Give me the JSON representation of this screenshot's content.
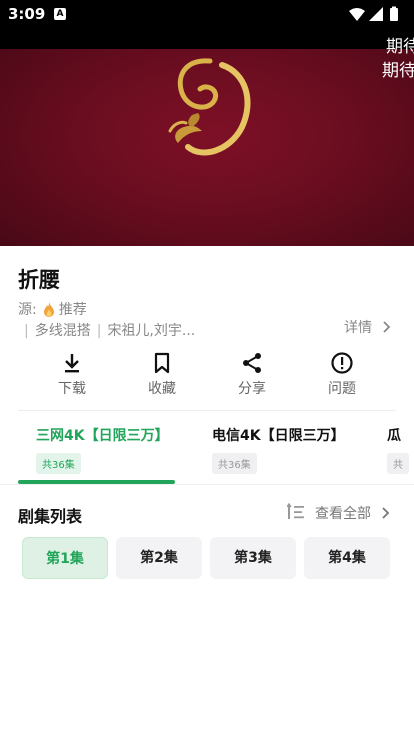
{
  "status_bar": {
    "time": "3:09",
    "notification_icon": "A",
    "icons": [
      "wifi-icon",
      "signal-icon",
      "battery-icon"
    ]
  },
  "video": {
    "danmaku": [
      "期待",
      "期待"
    ]
  },
  "show": {
    "title": "折腰",
    "source_label": "源:",
    "source_value": "推荐",
    "tags": [
      "多线混搭",
      "宋祖儿,刘宇..."
    ],
    "details_label": "详情"
  },
  "actions": [
    {
      "label": "下载",
      "icon": "download-icon"
    },
    {
      "label": "收藏",
      "icon": "bookmark-icon"
    },
    {
      "label": "分享",
      "icon": "share-icon"
    },
    {
      "label": "问题",
      "icon": "alert-icon"
    }
  ],
  "lines": [
    {
      "name": "三网4K【日限三万】",
      "count": "共36集",
      "active": true
    },
    {
      "name": "电信4K【日限三万】",
      "count": "共36集",
      "active": false
    },
    {
      "name": "瓜",
      "count": "共",
      "active": false
    }
  ],
  "episodes": {
    "heading": "剧集列表",
    "view_all": "查看全部",
    "items": [
      "第1集",
      "第2集",
      "第3集",
      "第4集"
    ]
  },
  "colors": {
    "accent": "#22a55a",
    "video_bg": "#6a0d20",
    "logo_gold": "#d9b24a"
  }
}
